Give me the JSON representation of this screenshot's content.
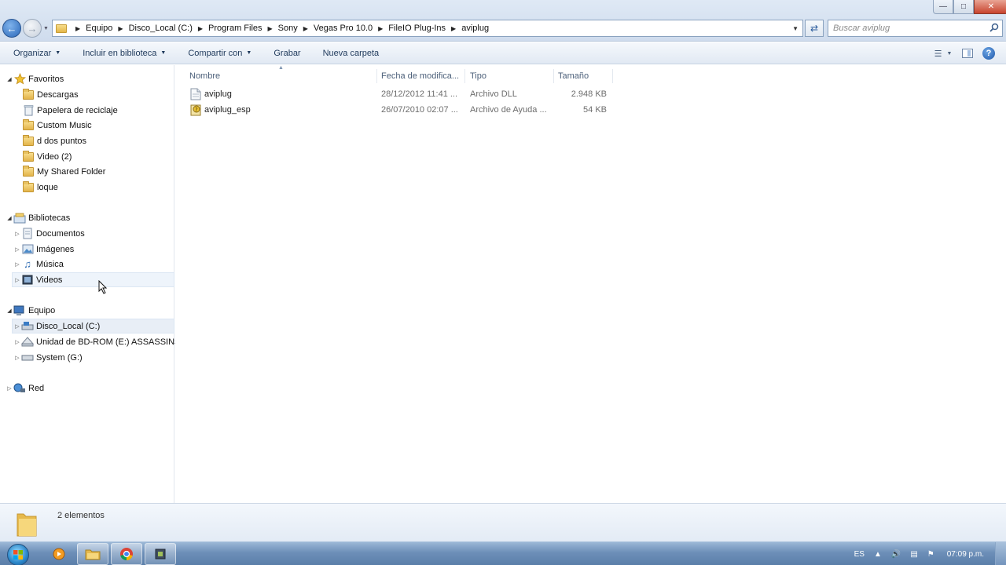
{
  "window": {
    "controls": {
      "minimize": "—",
      "maximize": "□",
      "close": "✕"
    }
  },
  "address": {
    "crumbs": [
      "Equipo",
      "Disco_Local (C:)",
      "Program Files",
      "Sony",
      "Vegas Pro 10.0",
      "FileIO Plug-Ins",
      "aviplug"
    ],
    "search_placeholder": "Buscar aviplug"
  },
  "toolbar": {
    "organize": "Organizar",
    "include_library": "Incluir en biblioteca",
    "share_with": "Compartir con",
    "burn": "Grabar",
    "new_folder": "Nueva carpeta"
  },
  "nav": {
    "favorites": {
      "label": "Favoritos",
      "items": [
        "Descargas",
        "Papelera de reciclaje",
        "Custom Music",
        "d dos puntos",
        "Video (2)",
        "My Shared Folder",
        "loque"
      ]
    },
    "libraries": {
      "label": "Bibliotecas",
      "items": [
        "Documentos",
        "Imágenes",
        "Música",
        "Videos"
      ]
    },
    "computer": {
      "label": "Equipo",
      "items": [
        "Disco_Local (C:)",
        "Unidad de BD-ROM (E:) ASSASSINS",
        "System (G:)"
      ]
    },
    "network": {
      "label": "Red"
    }
  },
  "columns": {
    "name": "Nombre",
    "date": "Fecha de modifica...",
    "type": "Tipo",
    "size": "Tamaño"
  },
  "files": [
    {
      "name": "aviplug",
      "date": "28/12/2012 11:41 ...",
      "type": "Archivo DLL",
      "size": "2.948 KB",
      "icon": "dll-file-icon"
    },
    {
      "name": "aviplug_esp",
      "date": "26/07/2010 02:07 ...",
      "type": "Archivo de Ayuda ...",
      "size": "54 KB",
      "icon": "help-file-icon"
    }
  ],
  "status": {
    "count": "2 elementos"
  },
  "taskbar": {
    "language": "ES",
    "clock": "07:09 p.m."
  },
  "colors": {
    "accent": "#2a67b8",
    "close_button": "#c8442e"
  }
}
